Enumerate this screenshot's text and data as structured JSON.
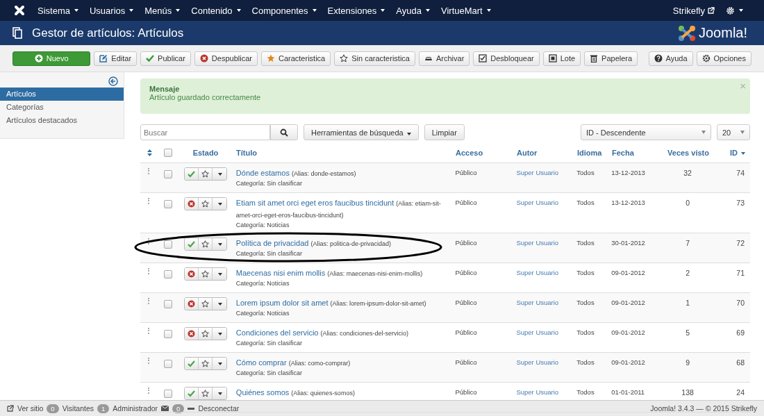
{
  "nav": {
    "menus": [
      {
        "label": "Sistema"
      },
      {
        "label": "Usuarios"
      },
      {
        "label": "Menús"
      },
      {
        "label": "Contenido"
      },
      {
        "label": "Componentes"
      },
      {
        "label": "Extensiones"
      },
      {
        "label": "Ayuda"
      },
      {
        "label": "VirtueMart"
      }
    ],
    "site": "Strikefly"
  },
  "header": {
    "title": "Gestor de artículos: Artículos",
    "brand": "Joomla!"
  },
  "toolbar": [
    {
      "label": "Nuevo",
      "primary": true
    },
    {
      "label": "Editar",
      "primary": false
    },
    {
      "label": "Publicar",
      "primary": false
    },
    {
      "label": "Despublicar",
      "primary": false
    },
    {
      "label": "Caracteristica",
      "primary": false
    },
    {
      "label": "Sin caracteristica",
      "primary": false
    },
    {
      "label": "Archivar",
      "primary": false
    },
    {
      "label": "Desbloquear",
      "primary": false
    },
    {
      "label": "Lote",
      "primary": false
    },
    {
      "label": "Papelera",
      "primary": false
    },
    {
      "label": "Ayuda",
      "primary": false
    },
    {
      "label": "Opciones",
      "primary": false
    }
  ],
  "sidebar": {
    "items": [
      {
        "label": "Artículos",
        "selected": true
      },
      {
        "label": "Categorías",
        "selected": false
      },
      {
        "label": "Artículos destacados",
        "selected": false
      }
    ]
  },
  "message": {
    "heading": "Mensaje",
    "text": "Artículo guardado correctamente",
    "close": "×"
  },
  "filters": {
    "search": {
      "placeholder": "Buscar"
    },
    "tools": "Herramientas de búsqueda",
    "clear": "Limpiar",
    "ordering": "ID - Descendente",
    "limit": "20"
  },
  "table": {
    "select_all": {
      "checked": false
    },
    "columns": [
      {
        "label": "Estado",
        "sorted": false
      },
      {
        "label": "Título",
        "sorted": false
      },
      {
        "label": "Acceso",
        "sorted": false
      },
      {
        "label": "Autor",
        "sorted": false
      },
      {
        "label": "Idioma",
        "sorted": false
      },
      {
        "label": "Fecha",
        "sorted": false
      },
      {
        "label": "Veces visto",
        "sorted": false
      },
      {
        "label": "ID",
        "sorted": true
      }
    ],
    "rows": [
      {
        "title": "Dónde estamos",
        "alias": "(Alias: donde-estamos)",
        "category": "Categoría: Sin clasificar",
        "access": "Público",
        "author": "Super Usuario",
        "language": "Todos",
        "date": "13-12-2013",
        "hits": "32",
        "id": "74",
        "published": true,
        "featured": false,
        "checked": false,
        "circled": false
      },
      {
        "title": "Etiam sit amet orci eget eros faucibus tincidunt",
        "alias": "(Alias: etiam-sit-amet-orci-eget-eros-faucibus-tincidunt)",
        "category": "Categoría: Noticias",
        "access": "Público",
        "author": "Super Usuario",
        "language": "Todos",
        "date": "13-12-2013",
        "hits": "0",
        "id": "73",
        "published": false,
        "featured": false,
        "checked": false,
        "circled": false
      },
      {
        "title": "Política de privacidad",
        "alias": "(Alias: politica-de-privacidad)",
        "category": "Categoría: Sin clasificar",
        "access": "Público",
        "author": "Super Usuario",
        "language": "Todos",
        "date": "30-01-2012",
        "hits": "7",
        "id": "72",
        "published": true,
        "featured": false,
        "checked": false,
        "circled": true
      },
      {
        "title": "Maecenas nisi enim mollis",
        "alias": "(Alias: maecenas-nisi-enim-mollis)",
        "category": "Categoría: Noticias",
        "access": "Público",
        "author": "Super Usuario",
        "language": "Todos",
        "date": "09-01-2012",
        "hits": "2",
        "id": "71",
        "published": false,
        "featured": false,
        "checked": false,
        "circled": false
      },
      {
        "title": "Lorem ipsum dolor sit amet",
        "alias": "(Alias: lorem-ipsum-dolor-sit-amet)",
        "category": "Categoría: Noticias",
        "access": "Público",
        "author": "Super Usuario",
        "language": "Todos",
        "date": "09-01-2012",
        "hits": "1",
        "id": "70",
        "published": false,
        "featured": false,
        "checked": false,
        "circled": false
      },
      {
        "title": "Condiciones del servicio",
        "alias": "(Alias: condiciones-del-servicio)",
        "category": "Categoría: Sin clasificar",
        "access": "Público",
        "author": "Super Usuario",
        "language": "Todos",
        "date": "09-01-2012",
        "hits": "5",
        "id": "69",
        "published": false,
        "featured": false,
        "checked": false,
        "circled": false
      },
      {
        "title": "Cómo comprar",
        "alias": "(Alias: como-comprar)",
        "category": "Categoría: Sin clasificar",
        "access": "Público",
        "author": "Super Usuario",
        "language": "Todos",
        "date": "09-01-2012",
        "hits": "9",
        "id": "68",
        "published": true,
        "featured": false,
        "checked": false,
        "circled": false
      },
      {
        "title": "Quiénes somos",
        "alias": "(Alias: quienes-somos)",
        "access": "Público",
        "author": "Super Usuario",
        "language": "Todos",
        "date": "01-01-2011",
        "hits": "138",
        "id": "24",
        "published": true,
        "featured": false,
        "checked": false,
        "circled": false
      }
    ]
  },
  "status_bar": {
    "view_site": "Ver sitio",
    "visitors_count": "0",
    "visitors": "Visitantes",
    "admins_count": "1",
    "admins": "Administrador",
    "messages_count": "0",
    "logout": "Desconectar",
    "version": "Joomla! 3.4.3 — © 2015 Strikefly"
  }
}
